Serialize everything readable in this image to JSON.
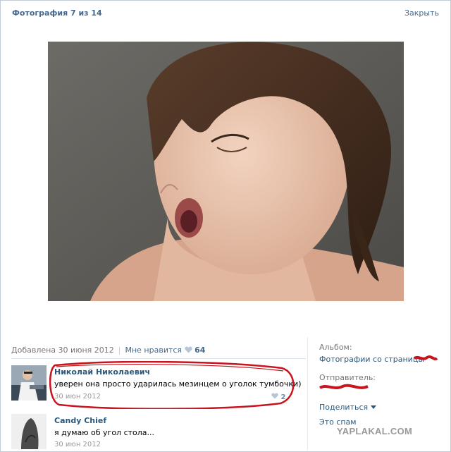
{
  "header": {
    "title": "Фотография 7 из 14",
    "close_label": "Закрыть"
  },
  "photo_meta": {
    "added": "Добавлена 30 июня 2012",
    "likes_label": "Мне нравится",
    "likes_count": "64"
  },
  "comments": [
    {
      "author": "Николай Николаевич",
      "text": "уверен она просто ударилась мезинцем о уголок тумбочки)",
      "date": "30 июн 2012",
      "likes": "2"
    },
    {
      "author": "Candy Chief",
      "text": "я думаю об угол стола...",
      "date": "30 июн 2012"
    }
  ],
  "sidebar": {
    "album_label": "Альбом:",
    "album_value": "Фотографии со страницы",
    "sender_label": "Отправитель:",
    "share_label": "Поделиться",
    "spam_label": "Это спам"
  },
  "watermark": "YAPLAKAL.COM",
  "colors": {
    "link": "#2b587a",
    "header_link": "#45688e",
    "annotation_red": "#c8141e"
  }
}
